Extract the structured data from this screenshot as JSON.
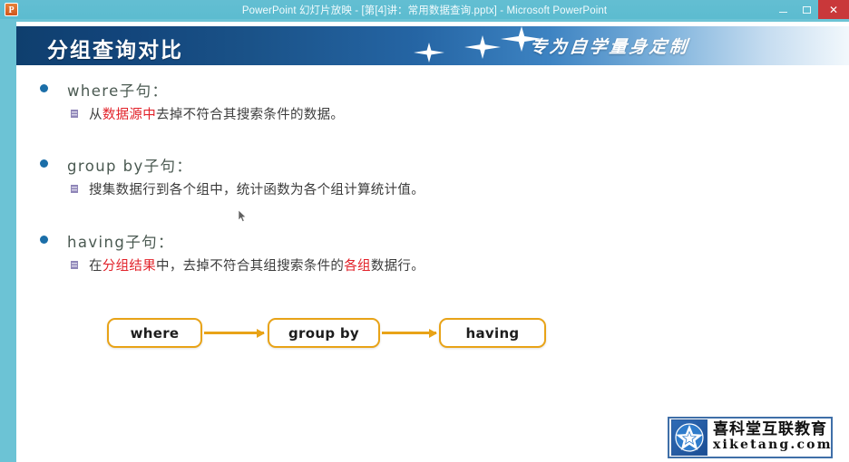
{
  "window": {
    "app_icon": "powerpoint-icon",
    "title": "PowerPoint 幻灯片放映 - [第[4]讲：常用数据查询.pptx] - Microsoft PowerPoint",
    "controls": {
      "minimize": "minimize-icon",
      "restore": "restore-icon",
      "close": "✕"
    },
    "titlebar_color": "#5cbcd0",
    "close_color": "#c9383a"
  },
  "slide": {
    "header": {
      "title": "分组查询对比",
      "slogan": "专为自学量身定制",
      "banner_color_dark": "#0f3f6e",
      "banner_color_light": "#f2f8fc"
    },
    "bullets": [
      {
        "heading": "where子句：",
        "detail_parts": [
          {
            "text": "从",
            "highlight": false
          },
          {
            "text": "数据源中",
            "highlight": true
          },
          {
            "text": "去掉不符合其搜索条件的数据。",
            "highlight": false
          }
        ]
      },
      {
        "heading": "group by子句：",
        "detail_parts": [
          {
            "text": "搜集数据行到各个组中，统计函数为各个组计算统计值。",
            "highlight": false
          }
        ]
      },
      {
        "heading": "having子句：",
        "detail_parts": [
          {
            "text": "在",
            "highlight": false
          },
          {
            "text": "分组结果",
            "highlight": true
          },
          {
            "text": "中，去掉不符合其组搜索条件的",
            "highlight": false
          },
          {
            "text": "各组",
            "highlight": true
          },
          {
            "text": "数据行。",
            "highlight": false
          }
        ]
      }
    ],
    "bullet_dot_color": "#1b6ea8",
    "highlight_color": "#e2222a",
    "flow": {
      "boxes": [
        "where",
        "group by",
        "having"
      ],
      "accent_color": "#e8a317"
    },
    "logo": {
      "emblem": "star-icon",
      "name_cn": "喜科堂互联教育",
      "name_en": "xiketang.com",
      "frame_color": "#3f6fa8"
    }
  }
}
